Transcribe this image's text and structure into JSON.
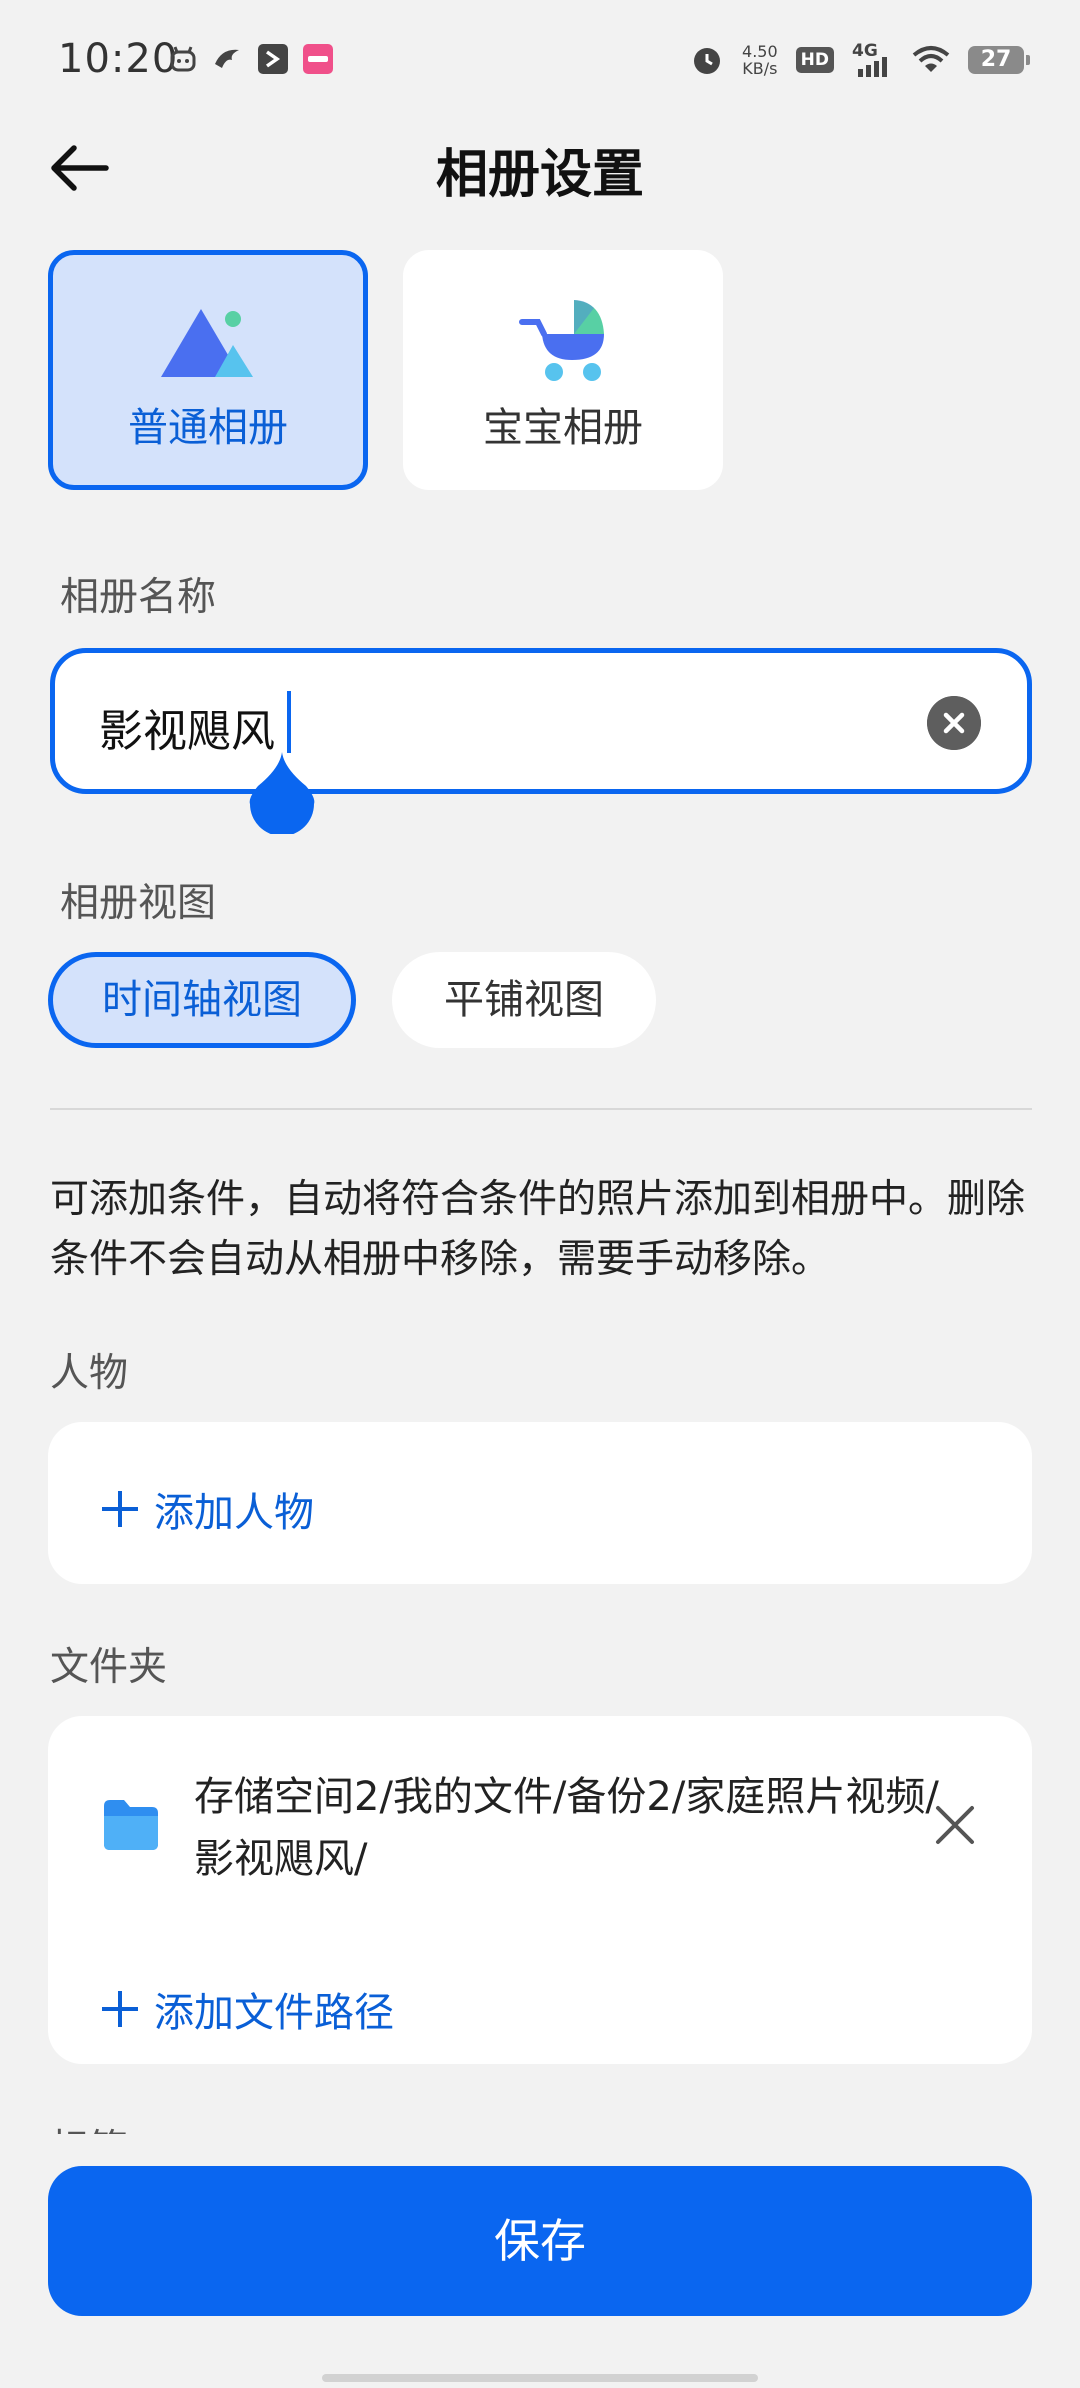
{
  "status_bar": {
    "time": "10:20",
    "net_speed_value": "4.50",
    "net_speed_unit": "KB/s",
    "hd": "HD",
    "network": "4G",
    "battery": "27",
    "icons": [
      "app-notification-icon",
      "bird-notification-icon",
      "arrow-notification-icon",
      "pink-app-notification-icon",
      "alarm-icon",
      "wifi-icon"
    ]
  },
  "header": {
    "title": "相册设置",
    "back_icon": "back-arrow-icon"
  },
  "album_types": [
    {
      "label": "普通相册",
      "icon": "mountain-icon",
      "selected": true
    },
    {
      "label": "宝宝相册",
      "icon": "stroller-icon",
      "selected": false
    }
  ],
  "album_name": {
    "label": "相册名称",
    "value": "影视飓风"
  },
  "album_view": {
    "label": "相册视图",
    "options": [
      {
        "label": "时间轴视图",
        "selected": true
      },
      {
        "label": "平铺视图",
        "selected": false
      }
    ]
  },
  "description": "可添加条件，自动将符合条件的照片添加到相册中。删除条件不会自动从相册中移除，需要手动移除。",
  "people": {
    "label": "人物",
    "add_label": "添加人物"
  },
  "folders": {
    "label": "文件夹",
    "items": [
      {
        "path": "存储空间2/我的文件/备份2/家庭照片视频/影视飓风/"
      }
    ],
    "add_label": "添加文件路径"
  },
  "tags": {
    "label": "标签"
  },
  "save_label": "保存",
  "colors": {
    "accent": "#0a66f0",
    "selected_bg": "#d4e2fb",
    "page_bg": "#f2f2f2"
  }
}
